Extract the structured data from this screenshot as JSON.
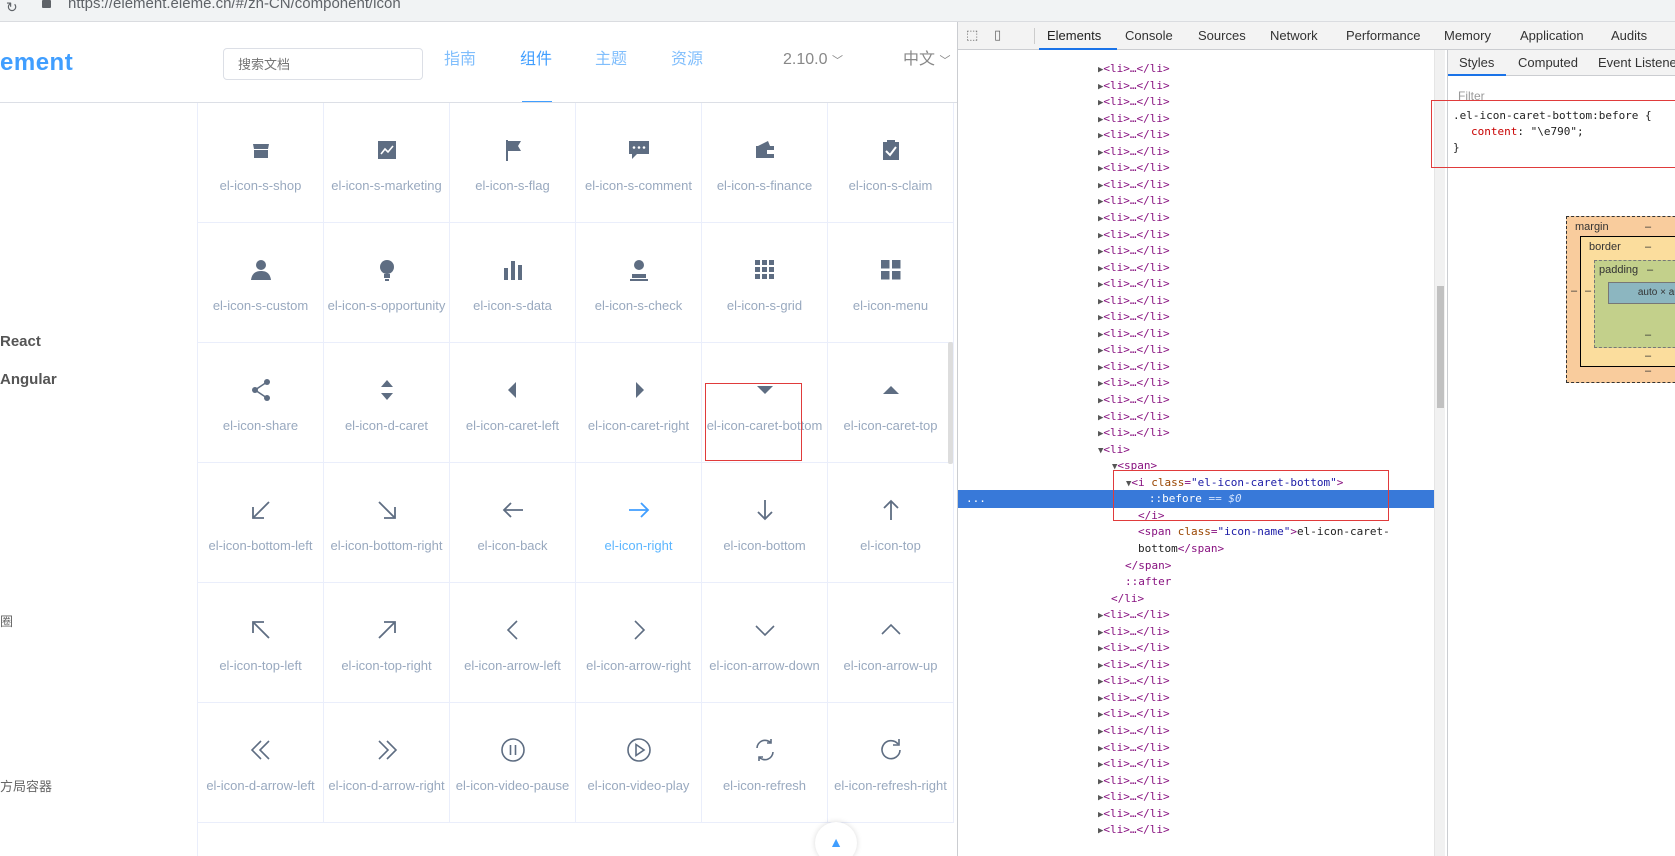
{
  "browser": {
    "url": "https://element.eleme.cn/#/zh-CN/component/icon"
  },
  "site": {
    "logo": "ement",
    "search_placeholder": "搜索文档",
    "nav": [
      "指南",
      "组件",
      "主题",
      "资源"
    ],
    "version": "2.10.0",
    "language": "中文",
    "sidebar": [
      "React",
      "Angular",
      "圈",
      "方局容器"
    ],
    "icons": [
      {
        "icon": "shop",
        "name": "el-icon-s-shop"
      },
      {
        "icon": "marketing",
        "name": "el-icon-s-marketing"
      },
      {
        "icon": "flag",
        "name": "el-icon-s-flag"
      },
      {
        "icon": "comment",
        "name": "el-icon-s-comment"
      },
      {
        "icon": "finance",
        "name": "el-icon-s-finance"
      },
      {
        "icon": "claim",
        "name": "el-icon-s-claim"
      },
      {
        "icon": "custom",
        "name": "el-icon-s-custom"
      },
      {
        "icon": "opportunity",
        "name": "el-icon-s-opportunity"
      },
      {
        "icon": "data",
        "name": "el-icon-s-data"
      },
      {
        "icon": "check",
        "name": "el-icon-s-check"
      },
      {
        "icon": "grid",
        "name": "el-icon-s-grid"
      },
      {
        "icon": "menu",
        "name": "el-icon-menu"
      },
      {
        "icon": "share",
        "name": "el-icon-share"
      },
      {
        "icon": "d-caret",
        "name": "el-icon-d-caret"
      },
      {
        "icon": "caret-left",
        "name": "el-icon-caret-left"
      },
      {
        "icon": "caret-right",
        "name": "el-icon-caret-right"
      },
      {
        "icon": "caret-bottom",
        "name": "el-icon-caret-bottom"
      },
      {
        "icon": "caret-top",
        "name": "el-icon-caret-top"
      },
      {
        "icon": "bottom-left",
        "name": "el-icon-bottom-left"
      },
      {
        "icon": "bottom-right",
        "name": "el-icon-bottom-right"
      },
      {
        "icon": "back",
        "name": "el-icon-back"
      },
      {
        "icon": "right",
        "name": "el-icon-right"
      },
      {
        "icon": "bottom",
        "name": "el-icon-bottom"
      },
      {
        "icon": "top",
        "name": "el-icon-top"
      },
      {
        "icon": "top-left",
        "name": "el-icon-top-left"
      },
      {
        "icon": "top-right",
        "name": "el-icon-top-right"
      },
      {
        "icon": "arrow-left",
        "name": "el-icon-arrow-left"
      },
      {
        "icon": "arrow-right",
        "name": "el-icon-arrow-right"
      },
      {
        "icon": "arrow-down",
        "name": "el-icon-arrow-down"
      },
      {
        "icon": "arrow-up",
        "name": "el-icon-arrow-up"
      },
      {
        "icon": "d-arrow-left",
        "name": "el-icon-d-arrow-left"
      },
      {
        "icon": "d-arrow-right",
        "name": "el-icon-d-arrow-right"
      },
      {
        "icon": "video-pause",
        "name": "el-icon-video-pause"
      },
      {
        "icon": "video-play",
        "name": "el-icon-video-play"
      },
      {
        "icon": "refresh",
        "name": "el-icon-refresh"
      },
      {
        "icon": "refresh-right",
        "name": "el-icon-refresh-right"
      }
    ],
    "highlighted_icon": "el-icon-right"
  },
  "devtools": {
    "tabs": [
      "Elements",
      "Console",
      "Sources",
      "Network",
      "Performance",
      "Memory",
      "Application",
      "Audits"
    ],
    "active_tab": "Elements",
    "styles_tabs": [
      "Styles",
      "Computed",
      "Event Listene"
    ],
    "filter": "Filter",
    "rule": {
      "selector": ".el-icon-caret-bottom:before {",
      "property": "content",
      "value": "\"\\e790\";",
      "close": "}"
    },
    "box_model": {
      "margin": "margin",
      "border": "border",
      "padding": "padding",
      "content": "auto × auto",
      "dash": "–"
    },
    "tree": {
      "collapsed_li": "<li>…</li>",
      "open_li": "<li>",
      "open_span": "<span>",
      "i_tag": "<i class=\"el-icon-caret-bottom\">",
      "i_tag_name": "<i",
      "i_attr": "class",
      "i_val": "\"el-icon-caret-bottom\"",
      "before": "::before",
      "before_ref": "== $0",
      "close_i": "</i>",
      "name_span_open": "<span",
      "name_span_attr": "class",
      "name_span_val": "\"icon-name\"",
      "name_span_text_1": "el-icon-caret-",
      "name_span_text_2": "bottom",
      "close_span_inner": "</span>",
      "close_span": "</span>",
      "after": "::after",
      "close_li": "</li>",
      "ellipsis": "..."
    }
  }
}
